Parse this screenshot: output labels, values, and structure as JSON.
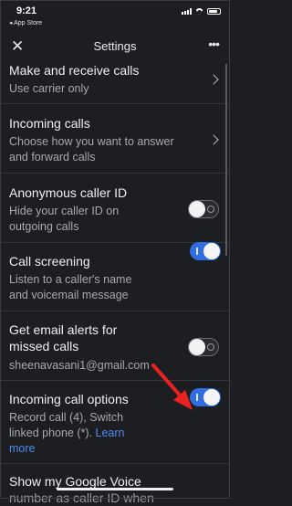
{
  "status": {
    "time": "9:21",
    "back_label": "◂ App Store"
  },
  "header": {
    "title": "Settings"
  },
  "items": [
    {
      "title": "Make and receive calls",
      "subtitle": "Use carrier only"
    },
    {
      "title": "Incoming calls",
      "subtitle_line1": "Choose how you want to answer",
      "subtitle_line2": "and forward calls"
    },
    {
      "title": "Anonymous caller ID",
      "subtitle_line1": "Hide your caller ID on",
      "subtitle_line2": "outgoing calls",
      "enabled": false
    },
    {
      "title": "Call screening",
      "subtitle_line1": "Listen to a caller's name",
      "subtitle_line2": "and voicemail message",
      "enabled": true
    },
    {
      "title_line1": "Get email alerts for",
      "title_line2": "missed calls",
      "subtitle": "sheenavasani1@gmail.com",
      "enabled": false
    },
    {
      "title": "Incoming call options",
      "subtitle_line1": "Record call (4), Switch",
      "subtitle_line2": "linked phone (*).",
      "link": "Learn",
      "link2": "more",
      "enabled": true
    },
    {
      "title_line1": "Show my Google Voice",
      "title_line2": "number as caller ID when"
    }
  ],
  "colors": {
    "background": "#1d1e22",
    "accent": "#2f6de0",
    "annotation_arrow": "#e8231f"
  }
}
